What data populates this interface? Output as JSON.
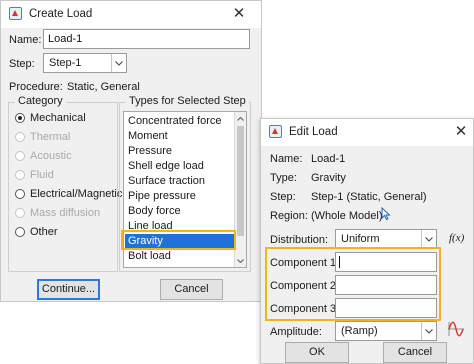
{
  "create_load": {
    "title": "Create Load",
    "close_glyph": "✕",
    "name_label": "Name:",
    "name_value": "Load-1",
    "step_label": "Step:",
    "step_value": "Step-1",
    "procedure_label": "Procedure:",
    "procedure_value": "Static, General",
    "category": {
      "title": "Category",
      "options": [
        {
          "label": "Mechanical",
          "checked": true,
          "enabled": true
        },
        {
          "label": "Thermal",
          "checked": false,
          "enabled": false
        },
        {
          "label": "Acoustic",
          "checked": false,
          "enabled": false
        },
        {
          "label": "Fluid",
          "checked": false,
          "enabled": false
        },
        {
          "label": "Electrical/Magnetic",
          "checked": false,
          "enabled": true
        },
        {
          "label": "Mass diffusion",
          "checked": false,
          "enabled": false
        },
        {
          "label": "Other",
          "checked": false,
          "enabled": true
        }
      ]
    },
    "types": {
      "title": "Types for Selected Step",
      "items": [
        "Concentrated force",
        "Moment",
        "Pressure",
        "Shell edge load",
        "Surface traction",
        "Pipe pressure",
        "Body force",
        "Line load",
        "Gravity",
        "Bolt load"
      ],
      "selected": "Gravity"
    },
    "continue_label": "Continue...",
    "cancel_label": "Cancel"
  },
  "edit_load": {
    "title": "Edit Load",
    "close_glyph": "✕",
    "name_label": "Name:",
    "name_value": "Load-1",
    "type_label": "Type:",
    "type_value": "Gravity",
    "step_label": "Step:",
    "step_value": "Step-1 (Static, General)",
    "region_label": "Region:",
    "region_value": "(Whole Model)",
    "distribution_label": "Distribution:",
    "distribution_value": "Uniform",
    "fx_label": "f(x)",
    "component1_label": "Component 1:",
    "component1_value": "",
    "component2_label": "Component 2:",
    "component2_value": "",
    "component3_label": "Component 3:",
    "component3_value": "",
    "amplitude_label": "Amplitude:",
    "amplitude_value": "(Ramp)",
    "ok_label": "OK",
    "cancel_label": "Cancel"
  },
  "colors": {
    "highlight": "#f2b41b",
    "selection": "#1e74d6",
    "accent_red": "#d9342b"
  },
  "icons": [
    "app-icon",
    "close-icon",
    "chevron-down-icon",
    "cursor-pointer-icon",
    "amplitude-curve-icon",
    "scroll-up-icon",
    "scroll-down-icon"
  ]
}
